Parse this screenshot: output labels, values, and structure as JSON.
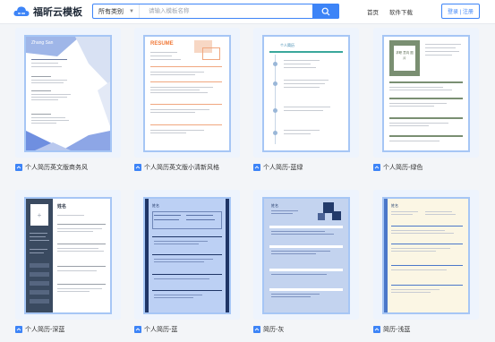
{
  "header": {
    "logo_text": "福昕云模板",
    "category_label": "所有类别",
    "search_placeholder": "请输入模板名称",
    "nav_home": "首页",
    "nav_download": "软件下载",
    "login_label": "登录 | 注册"
  },
  "colors": {
    "accent": "#3d84f7",
    "card_border": "#a6c6f5"
  },
  "templates": [
    {
      "title": "个人简历英文版商务风",
      "thumb_name": "Zhang San"
    },
    {
      "title": "个人简历英文版小清新风格",
      "thumb_name": "RESUME"
    },
    {
      "title": "个人简历-蓝绿",
      "thumb_name": "个人简历"
    },
    {
      "title": "个人简历-绿色",
      "thumb_name": "求职 意向 图片"
    },
    {
      "title": "个人简历-深蓝",
      "thumb_name": "姓名"
    },
    {
      "title": "个人简历-蓝",
      "thumb_name": "姓名"
    },
    {
      "title": "简历-灰",
      "thumb_name": "姓名"
    },
    {
      "title": "简历-浅蓝",
      "thumb_name": "姓名"
    }
  ]
}
